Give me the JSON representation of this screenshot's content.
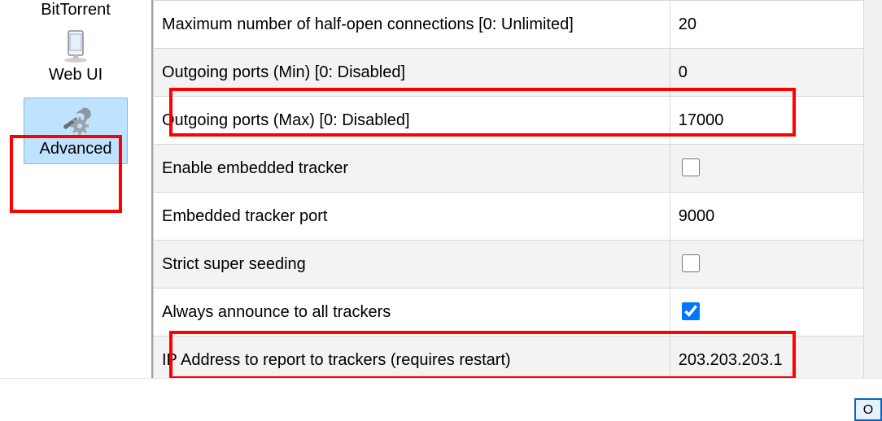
{
  "sidebar": {
    "items": [
      {
        "label": "BitTorrent",
        "icon": "bittorrent-icon"
      },
      {
        "label": "Web UI",
        "icon": "web-ui-icon"
      },
      {
        "label": "Advanced",
        "icon": "advanced-icon",
        "selected": true,
        "highlighted": true
      }
    ]
  },
  "settings": [
    {
      "key": "Maximum number of half-open connections [0: Unlimited]",
      "type": "number",
      "value": "20"
    },
    {
      "key": "Outgoing ports (Min) [0: Disabled]",
      "type": "number",
      "value": "0"
    },
    {
      "key": "Outgoing ports (Max) [0: Disabled]",
      "type": "number",
      "value": "17000",
      "highlighted": true
    },
    {
      "key": "Enable embedded tracker",
      "type": "checkbox",
      "checked": false
    },
    {
      "key": "Embedded tracker port",
      "type": "number",
      "value": "9000"
    },
    {
      "key": "Strict super seeding",
      "type": "checkbox",
      "checked": false
    },
    {
      "key": "Always announce to all trackers",
      "type": "checkbox",
      "checked": true
    },
    {
      "key": "IP Address to report to trackers (requires restart)",
      "type": "text",
      "value": "203.203.203.1",
      "highlighted": true
    }
  ],
  "buttons": {
    "ok_stub": "O"
  }
}
